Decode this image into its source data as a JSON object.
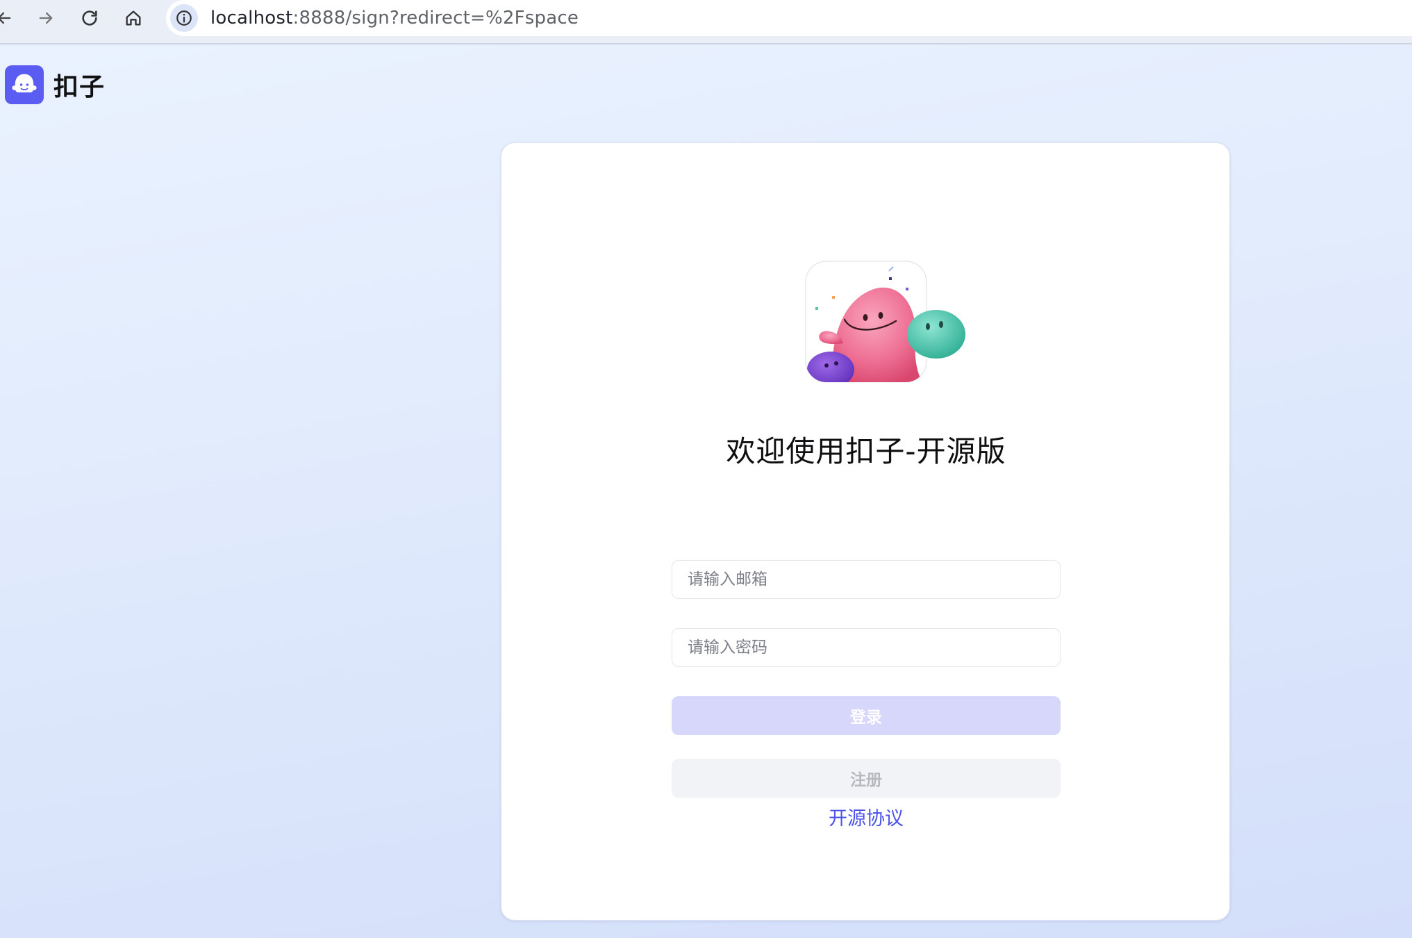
{
  "browser": {
    "url_host": "localhost",
    "url_path": ":8888/sign?redirect=%2Fspace",
    "icons": [
      "back-arrow-icon",
      "forward-arrow-icon",
      "reload-icon",
      "home-icon",
      "site-info-icon"
    ]
  },
  "header": {
    "brand_name": "扣子",
    "brand_icon": "coze-logo-icon"
  },
  "login": {
    "welcome_title": "欢迎使用扣子-开源版",
    "email_placeholder": "请输入邮箱",
    "password_placeholder": "请输入密码",
    "login_label": "登录",
    "register_label": "注册",
    "license_link": "开源协议"
  },
  "colors": {
    "accent": "#4d53e8",
    "login_button_disabled": "#d7d6fb",
    "register_button": "#f2f3f6",
    "brand_logo": "#5b5cf2"
  }
}
